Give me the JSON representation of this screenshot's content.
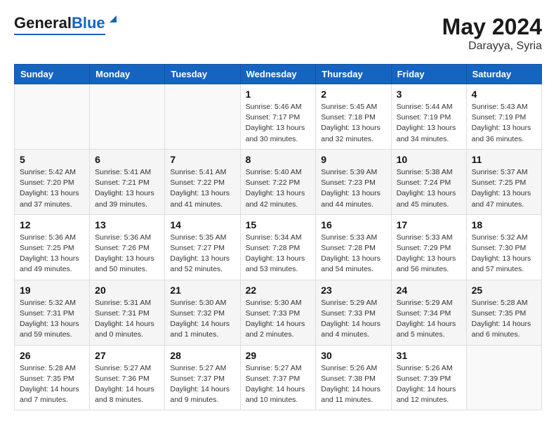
{
  "header": {
    "logo_general": "General",
    "logo_blue": "Blue",
    "month": "May 2024",
    "location": "Darayya, Syria"
  },
  "days_of_week": [
    "Sunday",
    "Monday",
    "Tuesday",
    "Wednesday",
    "Thursday",
    "Friday",
    "Saturday"
  ],
  "weeks": [
    [
      {
        "num": "",
        "sunrise": "",
        "sunset": "",
        "daylight": ""
      },
      {
        "num": "",
        "sunrise": "",
        "sunset": "",
        "daylight": ""
      },
      {
        "num": "",
        "sunrise": "",
        "sunset": "",
        "daylight": ""
      },
      {
        "num": "1",
        "sunrise": "Sunrise: 5:46 AM",
        "sunset": "Sunset: 7:17 PM",
        "daylight": "Daylight: 13 hours and 30 minutes."
      },
      {
        "num": "2",
        "sunrise": "Sunrise: 5:45 AM",
        "sunset": "Sunset: 7:18 PM",
        "daylight": "Daylight: 13 hours and 32 minutes."
      },
      {
        "num": "3",
        "sunrise": "Sunrise: 5:44 AM",
        "sunset": "Sunset: 7:19 PM",
        "daylight": "Daylight: 13 hours and 34 minutes."
      },
      {
        "num": "4",
        "sunrise": "Sunrise: 5:43 AM",
        "sunset": "Sunset: 7:19 PM",
        "daylight": "Daylight: 13 hours and 36 minutes."
      }
    ],
    [
      {
        "num": "5",
        "sunrise": "Sunrise: 5:42 AM",
        "sunset": "Sunset: 7:20 PM",
        "daylight": "Daylight: 13 hours and 37 minutes."
      },
      {
        "num": "6",
        "sunrise": "Sunrise: 5:41 AM",
        "sunset": "Sunset: 7:21 PM",
        "daylight": "Daylight: 13 hours and 39 minutes."
      },
      {
        "num": "7",
        "sunrise": "Sunrise: 5:41 AM",
        "sunset": "Sunset: 7:22 PM",
        "daylight": "Daylight: 13 hours and 41 minutes."
      },
      {
        "num": "8",
        "sunrise": "Sunrise: 5:40 AM",
        "sunset": "Sunset: 7:22 PM",
        "daylight": "Daylight: 13 hours and 42 minutes."
      },
      {
        "num": "9",
        "sunrise": "Sunrise: 5:39 AM",
        "sunset": "Sunset: 7:23 PM",
        "daylight": "Daylight: 13 hours and 44 minutes."
      },
      {
        "num": "10",
        "sunrise": "Sunrise: 5:38 AM",
        "sunset": "Sunset: 7:24 PM",
        "daylight": "Daylight: 13 hours and 45 minutes."
      },
      {
        "num": "11",
        "sunrise": "Sunrise: 5:37 AM",
        "sunset": "Sunset: 7:25 PM",
        "daylight": "Daylight: 13 hours and 47 minutes."
      }
    ],
    [
      {
        "num": "12",
        "sunrise": "Sunrise: 5:36 AM",
        "sunset": "Sunset: 7:25 PM",
        "daylight": "Daylight: 13 hours and 49 minutes."
      },
      {
        "num": "13",
        "sunrise": "Sunrise: 5:36 AM",
        "sunset": "Sunset: 7:26 PM",
        "daylight": "Daylight: 13 hours and 50 minutes."
      },
      {
        "num": "14",
        "sunrise": "Sunrise: 5:35 AM",
        "sunset": "Sunset: 7:27 PM",
        "daylight": "Daylight: 13 hours and 52 minutes."
      },
      {
        "num": "15",
        "sunrise": "Sunrise: 5:34 AM",
        "sunset": "Sunset: 7:28 PM",
        "daylight": "Daylight: 13 hours and 53 minutes."
      },
      {
        "num": "16",
        "sunrise": "Sunrise: 5:33 AM",
        "sunset": "Sunset: 7:28 PM",
        "daylight": "Daylight: 13 hours and 54 minutes."
      },
      {
        "num": "17",
        "sunrise": "Sunrise: 5:33 AM",
        "sunset": "Sunset: 7:29 PM",
        "daylight": "Daylight: 13 hours and 56 minutes."
      },
      {
        "num": "18",
        "sunrise": "Sunrise: 5:32 AM",
        "sunset": "Sunset: 7:30 PM",
        "daylight": "Daylight: 13 hours and 57 minutes."
      }
    ],
    [
      {
        "num": "19",
        "sunrise": "Sunrise: 5:32 AM",
        "sunset": "Sunset: 7:31 PM",
        "daylight": "Daylight: 13 hours and 59 minutes."
      },
      {
        "num": "20",
        "sunrise": "Sunrise: 5:31 AM",
        "sunset": "Sunset: 7:31 PM",
        "daylight": "Daylight: 14 hours and 0 minutes."
      },
      {
        "num": "21",
        "sunrise": "Sunrise: 5:30 AM",
        "sunset": "Sunset: 7:32 PM",
        "daylight": "Daylight: 14 hours and 1 minutes."
      },
      {
        "num": "22",
        "sunrise": "Sunrise: 5:30 AM",
        "sunset": "Sunset: 7:33 PM",
        "daylight": "Daylight: 14 hours and 2 minutes."
      },
      {
        "num": "23",
        "sunrise": "Sunrise: 5:29 AM",
        "sunset": "Sunset: 7:33 PM",
        "daylight": "Daylight: 14 hours and 4 minutes."
      },
      {
        "num": "24",
        "sunrise": "Sunrise: 5:29 AM",
        "sunset": "Sunset: 7:34 PM",
        "daylight": "Daylight: 14 hours and 5 minutes."
      },
      {
        "num": "25",
        "sunrise": "Sunrise: 5:28 AM",
        "sunset": "Sunset: 7:35 PM",
        "daylight": "Daylight: 14 hours and 6 minutes."
      }
    ],
    [
      {
        "num": "26",
        "sunrise": "Sunrise: 5:28 AM",
        "sunset": "Sunset: 7:35 PM",
        "daylight": "Daylight: 14 hours and 7 minutes."
      },
      {
        "num": "27",
        "sunrise": "Sunrise: 5:27 AM",
        "sunset": "Sunset: 7:36 PM",
        "daylight": "Daylight: 14 hours and 8 minutes."
      },
      {
        "num": "28",
        "sunrise": "Sunrise: 5:27 AM",
        "sunset": "Sunset: 7:37 PM",
        "daylight": "Daylight: 14 hours and 9 minutes."
      },
      {
        "num": "29",
        "sunrise": "Sunrise: 5:27 AM",
        "sunset": "Sunset: 7:37 PM",
        "daylight": "Daylight: 14 hours and 10 minutes."
      },
      {
        "num": "30",
        "sunrise": "Sunrise: 5:26 AM",
        "sunset": "Sunset: 7:38 PM",
        "daylight": "Daylight: 14 hours and 11 minutes."
      },
      {
        "num": "31",
        "sunrise": "Sunrise: 5:26 AM",
        "sunset": "Sunset: 7:39 PM",
        "daylight": "Daylight: 14 hours and 12 minutes."
      },
      {
        "num": "",
        "sunrise": "",
        "sunset": "",
        "daylight": ""
      }
    ]
  ]
}
